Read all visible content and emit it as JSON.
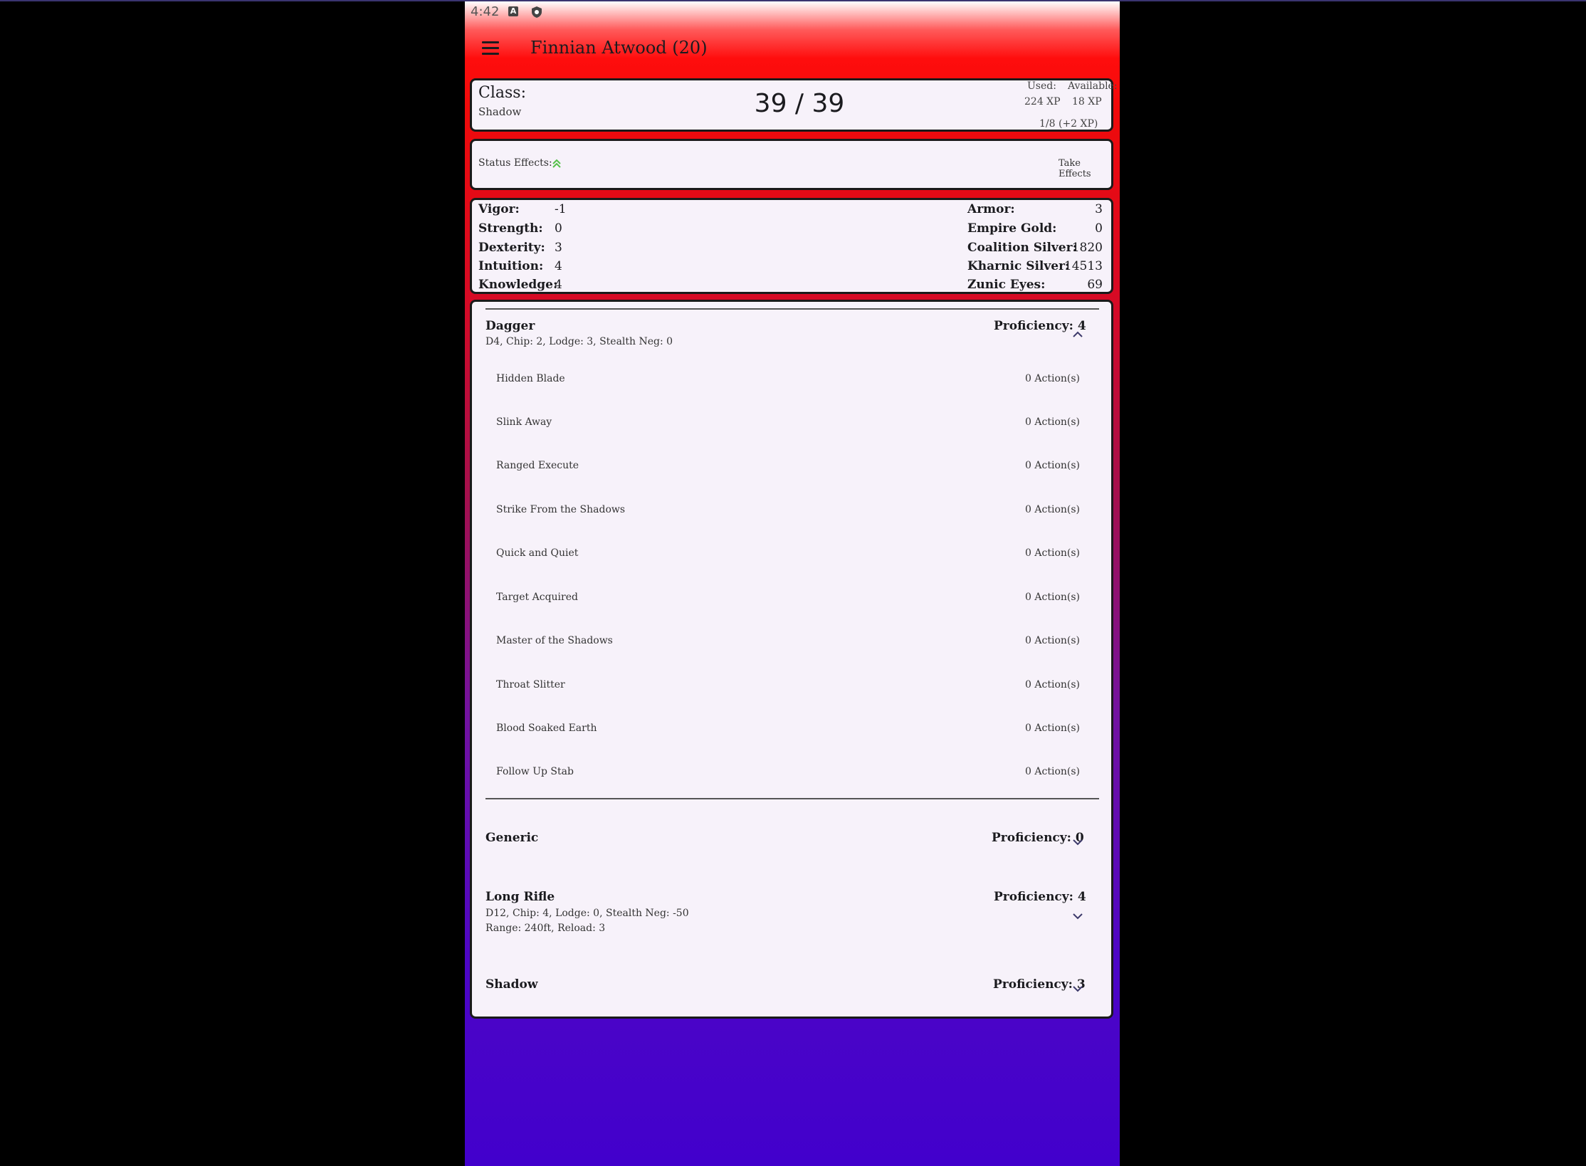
{
  "status_bar": {
    "time": "4:42",
    "icon_a": "A",
    "notification_icon": "shield-icon"
  },
  "app_bar": {
    "title": "Finnian Atwood (20)",
    "menu_icon": "hamburger-menu-icon"
  },
  "class_card": {
    "label": "Class:",
    "value": "Shadow",
    "hp": "39 / 39",
    "xp_used_label": "Used:",
    "xp_available_label": "Available:",
    "xp_used": "224 XP",
    "xp_available": "18 XP",
    "xp_level": "1/8 (+2 XP)"
  },
  "status_card": {
    "label": "Status Effects:",
    "icon": "double-chevron-up-icon",
    "action": "Take Effects",
    "accent": "#55c04a"
  },
  "stats": {
    "left": [
      {
        "label": "Vigor:",
        "value": "-1"
      },
      {
        "label": "Strength:",
        "value": "0"
      },
      {
        "label": "Dexterity:",
        "value": "3"
      },
      {
        "label": "Intuition:",
        "value": "4"
      },
      {
        "label": "Knowledge:",
        "value": "4"
      }
    ],
    "right": [
      {
        "label": "Armor:",
        "value": "3"
      },
      {
        "label": "Empire Gold:",
        "value": "0"
      },
      {
        "label": "Coalition Silver:",
        "value": "1820"
      },
      {
        "label": "Kharnic Silver:",
        "value": "14513"
      },
      {
        "label": "Zunic Eyes:",
        "value": "69"
      }
    ]
  },
  "weapons": [
    {
      "name": "Dagger",
      "details": [
        "D4, Chip: 2, Lodge: 3, Stealth Neg: 0"
      ],
      "proficiency": "Proficiency: 4",
      "expanded": true,
      "abilities": [
        {
          "name": "Hidden Blade",
          "cost": "0 Action(s)"
        },
        {
          "name": "Slink Away",
          "cost": "0 Action(s)"
        },
        {
          "name": "Ranged Execute",
          "cost": "0 Action(s)"
        },
        {
          "name": "Strike From the Shadows",
          "cost": "0 Action(s)"
        },
        {
          "name": "Quick and Quiet",
          "cost": "0 Action(s)"
        },
        {
          "name": "Target Acquired",
          "cost": "0 Action(s)"
        },
        {
          "name": "Master of the Shadows",
          "cost": "0 Action(s)"
        },
        {
          "name": "Throat Slitter",
          "cost": "0 Action(s)"
        },
        {
          "name": "Blood Soaked Earth",
          "cost": "0 Action(s)"
        },
        {
          "name": "Follow Up Stab",
          "cost": "0 Action(s)"
        }
      ]
    },
    {
      "name": "Generic",
      "details": [],
      "proficiency": "Proficiency: 0",
      "expanded": false
    },
    {
      "name": "Long Rifle",
      "details": [
        "D12, Chip: 4, Lodge: 0, Stealth Neg: -50",
        "Range: 240ft, Reload: 3"
      ],
      "proficiency": "Proficiency: 4",
      "expanded": false
    },
    {
      "name": "Shadow",
      "details": [],
      "proficiency": "Proficiency: 3",
      "expanded": false
    }
  ],
  "colors": {
    "gradient_top": "#ff0d0d",
    "gradient_bottom": "#4200cc",
    "card_background": "#f7f2fa",
    "chevron": "#3d3a6b"
  }
}
